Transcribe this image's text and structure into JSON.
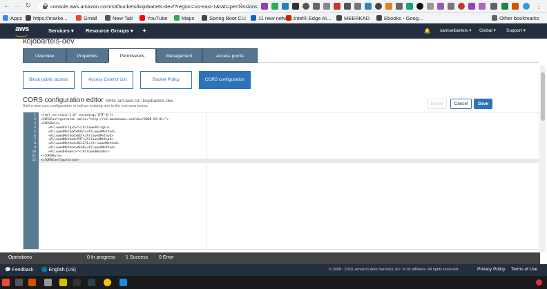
{
  "browser": {
    "url": "console.aws.amazon.com/s3/buckets/kojobartels-dev/?region=us-east-1&tab=permissions",
    "bookmarks": [
      {
        "label": "Apps",
        "color": "#4285f4"
      },
      {
        "label": "https://marke...",
        "color": "#444444"
      },
      {
        "label": "Gmail",
        "color": "#ea4335"
      },
      {
        "label": "New Tab",
        "color": "#555555"
      },
      {
        "label": "YouTube",
        "color": "#ff0000"
      },
      {
        "label": "Maps",
        "color": "#34a853"
      },
      {
        "label": "Spring Boot CLI",
        "color": "#444444"
      },
      {
        "label": "11 new netwo...",
        "color": "#0a66c2"
      },
      {
        "label": "Intel® Edge AI...",
        "color": "#cc2200"
      },
      {
        "label": "MEERKAD",
        "color": "#444444"
      },
      {
        "label": "Ebooks - Goog...",
        "color": "#444444"
      }
    ],
    "other_bookmarks": "Other bookmarks"
  },
  "aws_nav": {
    "logo": "aws",
    "services": "Services",
    "resource_groups": "Resource Groups",
    "account": "samuelbartels",
    "region": "Global",
    "support": "Support"
  },
  "page": {
    "bucket_name": "kojobartels-dev",
    "tabs": [
      {
        "label": "Overview"
      },
      {
        "label": "Properties"
      },
      {
        "label": "Permissions"
      },
      {
        "label": "Management"
      },
      {
        "label": "Access points"
      }
    ],
    "sub_buttons": [
      {
        "label": "Block public access"
      },
      {
        "label": "Access Control List"
      },
      {
        "label": "Bucket Policy"
      },
      {
        "label": "CORS configuration"
      }
    ],
    "editor_title": "CORS configuration editor",
    "arn": "ARN: arn:aws:s3:::kojobartels-dev",
    "editor_subtitle": "Add a new cors configuration or edit an existing one in the text area below.",
    "delete_label": "Delete",
    "cancel_label": "Cancel",
    "save_label": "Save",
    "code_lines": [
      "<?xml version=\"1.0\" encoding=\"UTF-8\"?>",
      "<CORSConfiguration xmlns=\"http://s3.amazonaws.com/doc/2006-03-01/\">",
      "<CORSRule>",
      "    <AllowedOrigin>*</AllowedOrigin>",
      "    <AllowedMethod>POST</AllowedMethod>",
      "    <AllowedMethod>GET</AllowedMethod>",
      "    <AllowedMethod>PUT</AllowedMethod>",
      "    <AllowedMethod>DELETE</AllowedMethod>",
      "    <AllowedMethod>HEAD</AllowedMethod>",
      "    <AllowedHeader>*</AllowedHeader>",
      "</CORSRule>",
      "</CORSConfiguration>"
    ]
  },
  "operations": {
    "label": "Operations",
    "in_progress": "0 In progress",
    "success": "1 Success",
    "error": "0 Error"
  },
  "footer": {
    "feedback": "Feedback",
    "language": "English (US)",
    "copyright": "© 2008 - 2020, Amazon Web Services, Inc. or its affiliates. All rights reserved.",
    "privacy": "Privacy Policy",
    "terms": "Terms of Use"
  }
}
